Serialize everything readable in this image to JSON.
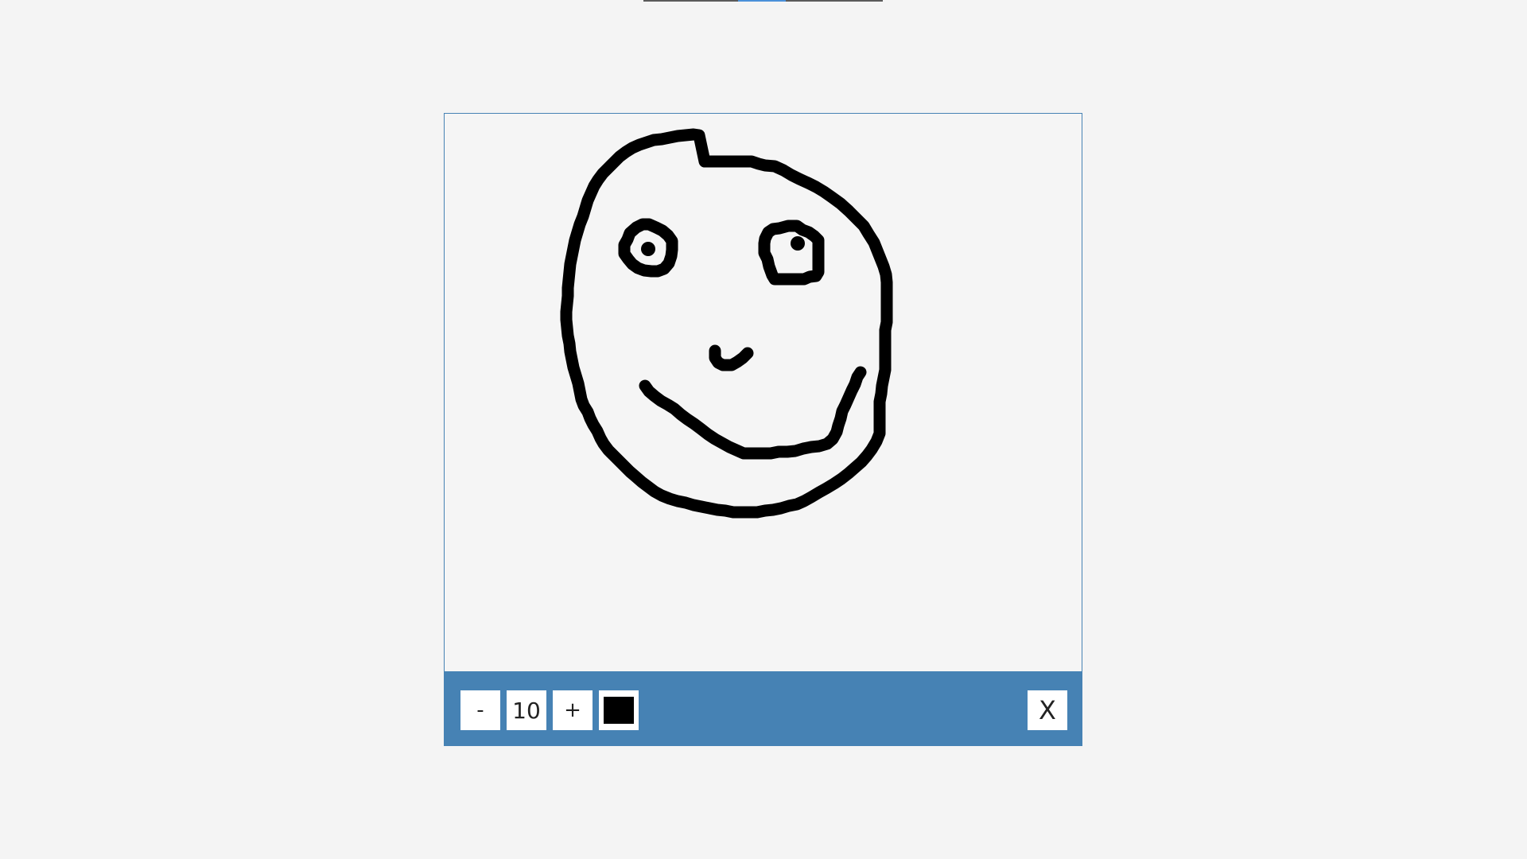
{
  "toolbar": {
    "decrease_label": "-",
    "brush_size": "10",
    "increase_label": "+",
    "close_label": "X"
  },
  "colors": {
    "background": "#f4f4f4",
    "toolbar": "#4682b4",
    "canvas": "#f5f5f5",
    "brush_color": "#000000",
    "accent": "#4a90d9"
  },
  "icons": {
    "color_picker": "color-swatch-icon"
  }
}
